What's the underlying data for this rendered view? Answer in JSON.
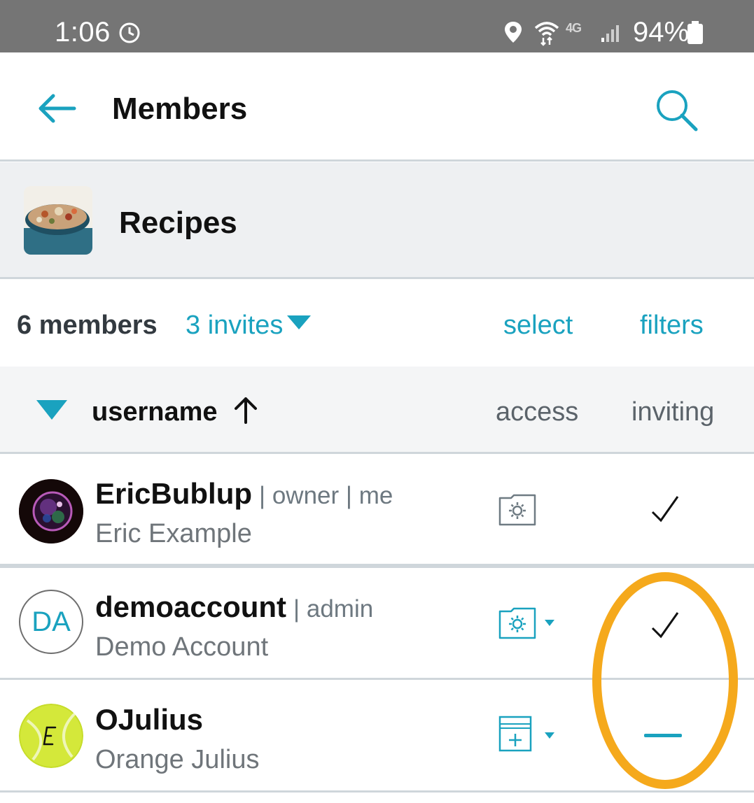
{
  "status_bar": {
    "time": "1:06",
    "network": "4G",
    "battery": "94%",
    "icons": [
      "alarm-clock-icon",
      "location-icon",
      "wifi-icon",
      "signal-icon",
      "battery-icon"
    ]
  },
  "app_bar": {
    "title": "Members",
    "back_icon": "arrow-left-icon",
    "search_icon": "search-icon"
  },
  "group": {
    "name": "Recipes",
    "thumbnail": "soup-pot-photo"
  },
  "counts": {
    "members": "6 members",
    "invites": "3 invites",
    "select": "select",
    "filters": "filters"
  },
  "columns": {
    "username": "username",
    "access": "access",
    "inviting": "inviting"
  },
  "members": [
    {
      "username": "EricBublup",
      "role": "| owner | me",
      "full_name": "Eric Example",
      "avatar": "bubble-photo",
      "access_icon": "folder-gear-icon",
      "inviting": "check"
    },
    {
      "username": "demoaccount",
      "role": "| admin",
      "full_name": "Demo Account",
      "avatar_initials": "DA",
      "access_icon": "folder-gear-icon",
      "inviting": "check"
    },
    {
      "username": "OJulius",
      "role": "",
      "full_name": "Orange Julius",
      "avatar": "tennis-ball-photo",
      "access_icon": "doc-plus-icon",
      "inviting": "dash"
    }
  ],
  "colors": {
    "accent": "#1aa2bf",
    "highlight": "#f5a91c",
    "status_bar": "#757575",
    "divider": "#cfd6db"
  }
}
